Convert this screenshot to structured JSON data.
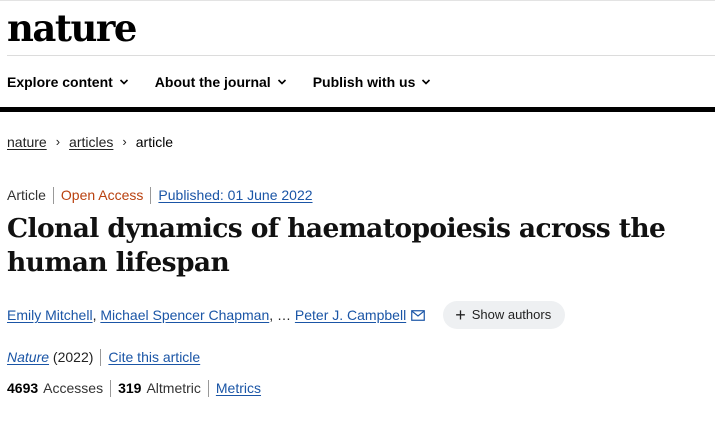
{
  "header": {
    "logo": "nature"
  },
  "nav": {
    "items": [
      {
        "label": "Explore content"
      },
      {
        "label": "About the journal"
      },
      {
        "label": "Publish with us"
      }
    ]
  },
  "breadcrumb": {
    "items": [
      "nature",
      "articles"
    ],
    "current": "article",
    "separator": "›"
  },
  "article": {
    "type": "Article",
    "access": "Open Access",
    "published": "Published: 01 June 2022",
    "title": "Clonal dynamics of haematopoiesis across the human lifespan",
    "authors": {
      "first": "Emily Mitchell",
      "second": "Michael Spencer Chapman",
      "separator": ",",
      "ellipsis": ", …",
      "last": "Peter J. Campbell",
      "show_authors_label": "Show authors",
      "show_authors_icon": "plus-icon",
      "corresponding_icon": "mail-icon"
    },
    "journal": "Nature",
    "year": "(2022)",
    "cite_label": "Cite this article",
    "metrics": {
      "accesses_value": "4693",
      "accesses_label": "Accesses",
      "altmetric_value": "319",
      "altmetric_label": "Altmetric",
      "metrics_link": "Metrics"
    }
  },
  "colors": {
    "link": "#1a55a6",
    "open_access": "#b9410f",
    "bar": "#000000"
  }
}
